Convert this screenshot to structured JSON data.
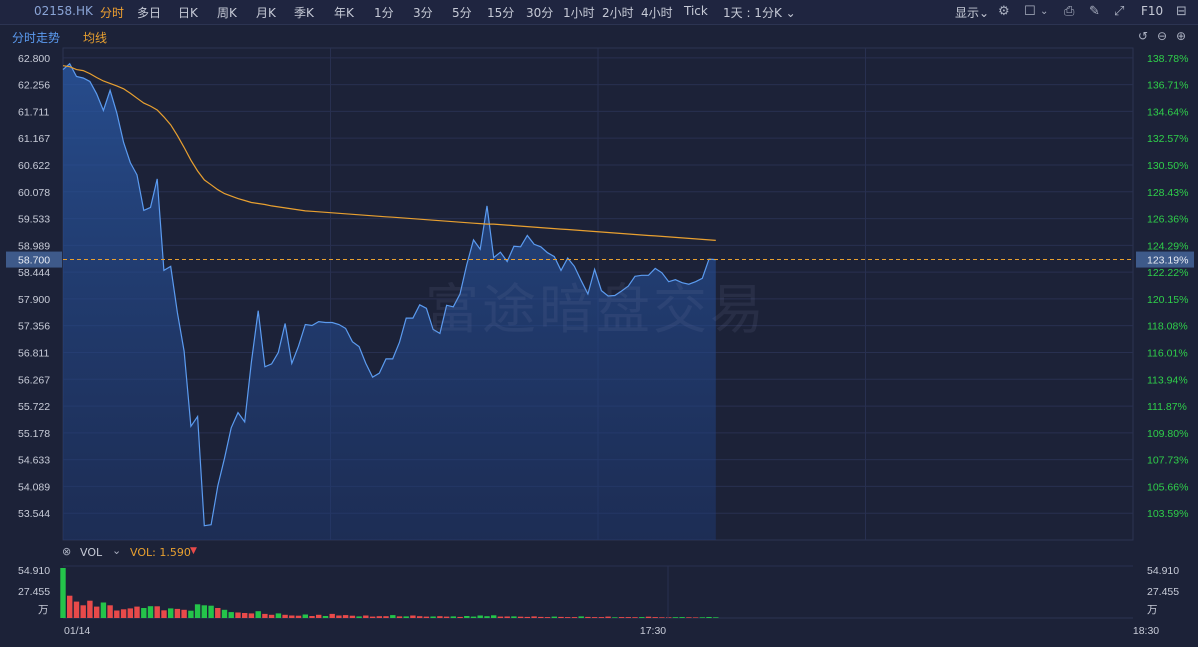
{
  "toolbar": {
    "ticker": "02158.HK",
    "periods": [
      "分时",
      "多日",
      "日K",
      "周K",
      "月K",
      "季K",
      "年K",
      "1分",
      "3分",
      "5分",
      "15分",
      "30分",
      "1小时",
      "2小时",
      "4小时",
      "Tick"
    ],
    "active_period": "分时",
    "day_selector": "1天 : 1分K",
    "display_label": "显示",
    "f10_label": "F10"
  },
  "subtabs": {
    "intraday_label": "分时走势",
    "avg_label": "均线"
  },
  "watermark": "富途暗盘交易",
  "volume_header": {
    "name": "VOL",
    "value_label": "VOL: 1.590"
  },
  "colors": {
    "background": "#1c2238",
    "price_line": "#5b9bf0",
    "avg_line": "#e8a030",
    "up": "#e84a4a",
    "down": "#24c44a",
    "axis_text": "#c8ccd8",
    "pct_up": "#2fcf4a",
    "current_marker": "#3e5a8a"
  },
  "chart_data": [
    {
      "type": "line",
      "x": [
        0,
        1,
        2,
        3,
        4,
        5,
        6,
        7,
        8,
        9,
        10,
        11,
        12,
        13,
        14,
        15,
        16,
        17,
        18,
        19,
        20,
        21,
        22,
        23,
        24,
        25,
        26,
        27,
        28,
        29,
        30,
        31,
        32,
        33,
        34,
        35,
        36,
        37,
        38,
        39,
        40,
        41,
        42,
        43,
        44,
        45,
        46,
        47,
        48,
        49,
        50,
        51,
        52,
        53,
        54,
        55,
        56,
        57,
        58,
        59,
        60,
        61,
        62,
        63,
        64,
        65,
        66,
        67,
        68,
        69,
        70,
        71,
        72,
        73,
        74,
        75,
        76,
        77,
        78,
        79,
        80,
        81,
        82,
        83,
        84,
        85,
        86,
        87,
        88,
        89,
        90,
        91,
        92,
        93,
        94,
        95,
        96,
        97,
        98,
        99,
        100,
        101,
        102,
        103,
        104,
        105,
        106,
        107,
        108,
        109,
        110,
        111
      ],
      "series": [
        {
          "values": [
            62.56,
            62.68,
            62.42,
            62.39,
            62.32,
            62.07,
            61.73,
            62.14,
            61.68,
            61.08,
            60.67,
            60.42,
            59.7,
            59.76,
            60.34,
            58.48,
            58.56,
            57.62,
            56.84,
            55.31,
            55.51,
            53.29,
            53.31,
            54.1,
            54.66,
            55.28,
            55.59,
            55.4,
            56.62,
            57.66,
            56.52,
            56.58,
            56.81,
            57.4,
            56.59,
            56.94,
            57.38,
            57.36,
            57.44,
            57.42,
            57.42,
            57.38,
            57.3,
            57.03,
            56.93,
            56.59,
            56.31,
            56.39,
            56.68,
            56.68,
            57.02,
            57.51,
            57.51,
            57.78,
            57.71,
            57.28,
            57.2,
            57.77,
            57.74,
            58.0,
            58.6,
            59.1,
            58.91,
            59.79,
            58.74,
            58.85,
            58.66,
            58.97,
            58.96,
            59.19,
            59.01,
            58.96,
            58.84,
            58.76,
            58.48,
            58.73,
            58.56,
            58.27,
            58.0,
            58.5,
            58.07,
            57.96,
            57.97,
            58.06,
            58.16,
            58.36,
            58.38,
            58.38,
            58.52,
            58.43,
            58.25,
            58.29,
            58.23,
            58.2,
            58.25,
            58.32,
            58.71,
            58.7
          ],
          "note": ""
        },
        {
          "values": [
            62.64,
            62.62,
            62.56,
            62.54,
            62.48,
            62.4,
            62.33,
            62.28,
            62.23,
            62.17,
            62.08,
            61.98,
            61.88,
            61.82,
            61.74,
            61.6,
            61.44,
            61.22,
            60.98,
            60.72,
            60.5,
            60.32,
            60.22,
            60.12,
            60.04,
            59.99,
            59.94,
            59.9,
            59.86,
            59.84,
            59.82,
            59.79,
            59.77,
            59.75,
            59.73,
            59.71,
            59.69,
            59.68,
            59.67,
            59.66,
            59.65,
            59.64,
            59.63,
            59.62,
            59.61,
            59.6,
            59.59,
            59.58,
            59.57,
            59.56,
            59.55,
            59.54,
            59.53,
            59.52,
            59.51,
            59.5,
            59.49,
            59.48,
            59.47,
            59.46,
            59.45,
            59.44,
            59.43,
            59.42,
            59.42,
            59.41,
            59.4,
            59.39,
            59.38,
            59.37,
            59.36,
            59.35,
            59.34,
            59.33,
            59.32,
            59.31,
            59.3,
            59.29,
            59.28,
            59.27,
            59.26,
            59.25,
            59.24,
            59.23,
            59.22,
            59.21,
            59.2,
            59.19,
            59.18,
            59.17,
            59.16,
            59.15,
            59.14,
            59.13,
            59.12,
            59.11,
            59.1,
            59.09
          ],
          "note": ""
        }
      ],
      "ylim": [
        53.0,
        63.0
      ],
      "y_ticks_left": [
        "62.800",
        "62.256",
        "61.711",
        "61.167",
        "60.622",
        "60.078",
        "59.533",
        "58.989",
        "58.444",
        "57.900",
        "57.356",
        "56.811",
        "56.267",
        "55.722",
        "55.178",
        "54.633",
        "54.089",
        "53.544"
      ],
      "y_ticks_right": [
        "138.78%",
        "136.71%",
        "134.64%",
        "132.57%",
        "130.50%",
        "128.43%",
        "126.36%",
        "124.29%",
        "122.22%",
        "120.15%",
        "118.08%",
        "116.01%",
        "113.94%",
        "111.87%",
        "109.80%",
        "107.73%",
        "105.66%",
        "103.59%"
      ],
      "current_price_label": "58.700",
      "current_pct_label": "123.19%",
      "x_tick_labels": [
        "01/14",
        "17:30",
        "18:30"
      ]
    },
    {
      "type": "bar",
      "ylim": [
        0,
        54.91
      ],
      "y_ticks_left": [
        "54.910",
        "27.455",
        "万"
      ],
      "y_ticks_right": [
        "54.910",
        "27.455",
        "万"
      ],
      "values": [
        54.91,
        24.5,
        18.0,
        14.0,
        19.0,
        12.5,
        17.0,
        14.0,
        8.2,
        9.5,
        10.5,
        12.5,
        11.0,
        13.0,
        12.8,
        8.5,
        10.5,
        10.0,
        9.0,
        8.0,
        15.0,
        14.0,
        13.5,
        11.0,
        9.0,
        6.5,
        6.0,
        5.5,
        5.0,
        7.5,
        4.5,
        3.5,
        5.0,
        3.5,
        2.8,
        2.5,
        3.8,
        2.2,
        3.5,
        2.2,
        4.5,
        2.8,
        3.2,
        2.5,
        1.8,
        2.8,
        1.5,
        2.0,
        2.0,
        3.2,
        1.8,
        1.8,
        2.8,
        2.0,
        1.5,
        1.6,
        2.0,
        1.5,
        1.8,
        1.2,
        2.2,
        1.5,
        2.8,
        2.0,
        3.0,
        1.5,
        1.6,
        1.8,
        1.4,
        1.2,
        1.8,
        1.2,
        1.0,
        1.5,
        1.2,
        1.0,
        1.0,
        1.8,
        1.2,
        1.0,
        1.0,
        1.5,
        0.8,
        1.0,
        1.0,
        0.9,
        1.0,
        1.4,
        1.0,
        0.8,
        0.8,
        0.9,
        1.0,
        0.8,
        0.7,
        0.8,
        1.1,
        0.8
      ],
      "up_down": [
        "d",
        "u",
        "u",
        "u",
        "u",
        "u",
        "d",
        "u",
        "u",
        "u",
        "u",
        "u",
        "d",
        "d",
        "u",
        "u",
        "d",
        "u",
        "u",
        "d",
        "d",
        "d",
        "d",
        "u",
        "d",
        "d",
        "u",
        "u",
        "u",
        "d",
        "u",
        "u",
        "d",
        "u",
        "u",
        "u",
        "d",
        "u",
        "u",
        "d",
        "u",
        "u",
        "u",
        "u",
        "d",
        "u",
        "u",
        "u",
        "u",
        "d",
        "u",
        "d",
        "u",
        "u",
        "u",
        "d",
        "u",
        "u",
        "d",
        "u",
        "d",
        "d",
        "d",
        "d",
        "d",
        "u",
        "u",
        "d",
        "u",
        "u",
        "u",
        "u",
        "u",
        "d",
        "u",
        "u",
        "u",
        "d",
        "u",
        "u",
        "u",
        "u",
        "d",
        "u",
        "u",
        "u",
        "d",
        "u",
        "u",
        "u",
        "u",
        "d",
        "d",
        "u",
        "u",
        "d",
        "d",
        "d"
      ]
    }
  ]
}
